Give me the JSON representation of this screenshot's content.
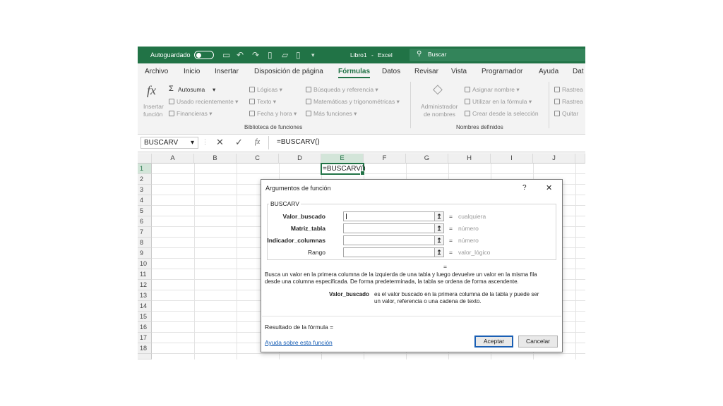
{
  "titlebar": {
    "autosave_label": "Autoguardado",
    "filename": "Libro1",
    "separator": "-",
    "app_name": "Excel",
    "search_placeholder": "Buscar"
  },
  "menu": {
    "tabs": [
      "Archivo",
      "Inicio",
      "Insertar",
      "Disposición de página",
      "Fórmulas",
      "Datos",
      "Revisar",
      "Vista",
      "Programador",
      "Ayuda",
      "Dat"
    ],
    "active_tab": "Fórmulas"
  },
  "ribbon": {
    "insert_function": [
      "Insertar",
      "función"
    ],
    "autosum": "Autosuma",
    "recent": "Usado recientemente",
    "financial": "Financieras",
    "logical": "Lógicas",
    "text": "Texto",
    "datetime": "Fecha y hora",
    "lookup": "Búsqueda y referencia",
    "math": "Matemáticas y trigonométricas",
    "more": "Más funciones",
    "library_group": "Biblioteca de funciones",
    "name_manager": [
      "Administrador",
      "de nombres"
    ],
    "assign_name": "Asignar nombre",
    "use_in_formula": "Utilizar en la fórmula",
    "create_from_selection": "Crear desde la selección",
    "names_group": "Nombres definidos",
    "trace1": "Rastrea",
    "trace2": "Rastrea",
    "remove": "Quitar"
  },
  "formula_bar": {
    "name_box": "BUSCARV",
    "fx": "fx",
    "formula": "=BUSCARV()"
  },
  "grid": {
    "columns": [
      "A",
      "B",
      "C",
      "D",
      "E",
      "F",
      "G",
      "H",
      "I",
      "J"
    ],
    "rows": [
      "1",
      "2",
      "3",
      "4",
      "5",
      "6",
      "7",
      "8",
      "9",
      "10",
      "11",
      "12",
      "13",
      "14",
      "15",
      "16",
      "17",
      "18"
    ],
    "active_cell_text": "=BUSCARV()"
  },
  "dialog": {
    "title": "Argumentos de función",
    "help_glyph": "?",
    "close_glyph": "✕",
    "function_name": "BUSCARV",
    "args": [
      {
        "label": "Valor_buscado",
        "value": "cualquiera"
      },
      {
        "label": "Matriz_tabla",
        "value": "número"
      },
      {
        "label": "Indicador_columnas",
        "value": "número"
      },
      {
        "label": "Rango",
        "value": "valor_lógico"
      }
    ],
    "eq": "=",
    "description_1": "Busca un valor en la primera columna de la izquierda de una tabla y luego devuelve un valor en la misma fila",
    "description_2": "desde una columna especificada. De forma predeterminada, la tabla se ordena de forma ascendente.",
    "arg_help_name": "Valor_buscado",
    "arg_help_1": "es el valor buscado en la primera columna de la tabla y puede ser",
    "arg_help_2": "un valor, referencia o una cadena de texto.",
    "result_label": "Resultado de la fórmula =",
    "help_link": "Ayuda sobre esta función",
    "ok": "Aceptar",
    "cancel": "Cancelar"
  }
}
